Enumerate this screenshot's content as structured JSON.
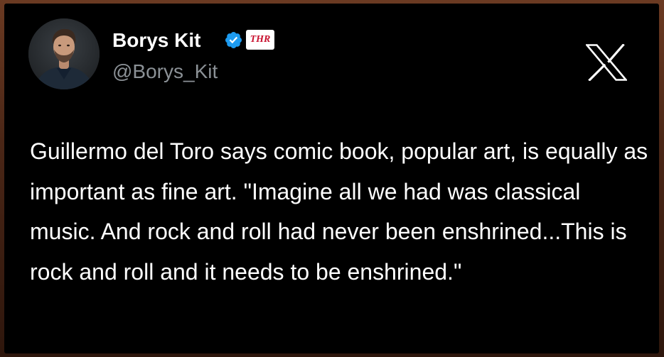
{
  "author": {
    "display_name": "Borys Kit",
    "handle": "@Borys_Kit",
    "affiliation_badge": "THR",
    "verified": true,
    "verified_color": "#1d9bf0"
  },
  "platform": {
    "logo_icon": "x-logo-icon"
  },
  "tweet": {
    "text": "Guillermo del Toro says comic book, popular art, is equally as important as fine art. \"Imagine all we had was classical music. And rock and roll had never been enshrined...This is rock and roll and it needs to be enshrined.\""
  },
  "colors": {
    "card_background": "#000000",
    "text_primary": "#ffffff",
    "text_secondary": "#8b9196",
    "badge_red": "#c8102e"
  }
}
